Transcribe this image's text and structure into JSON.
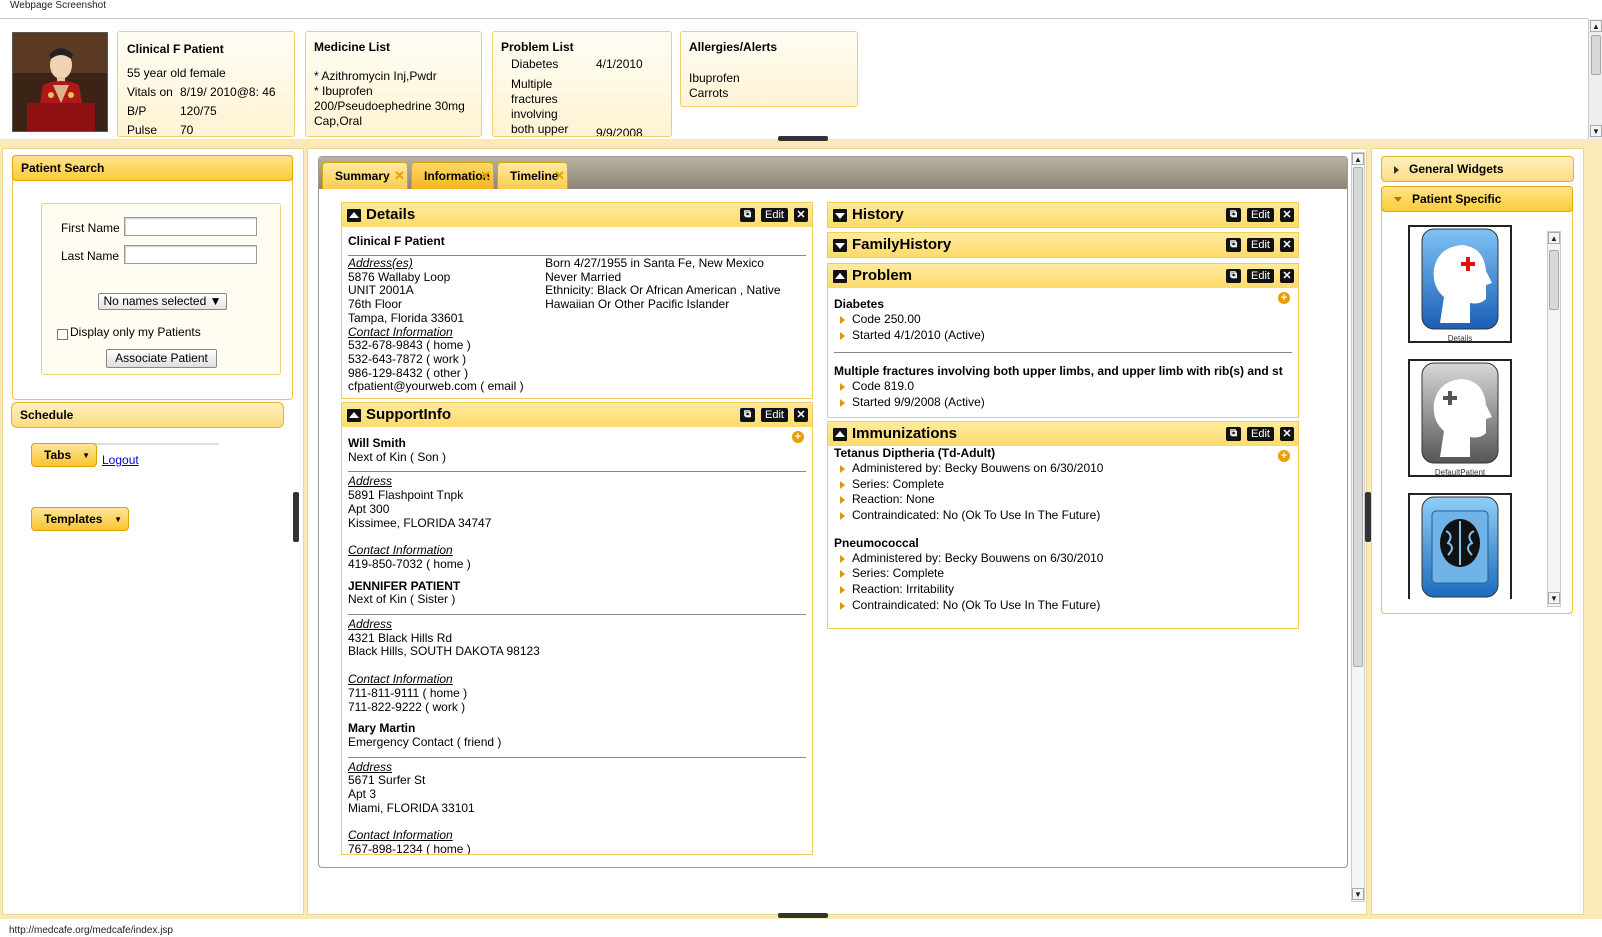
{
  "window": {
    "title": "Webpage Screenshot"
  },
  "header": {
    "patient": {
      "name": "Clinical F Patient",
      "desc": "55 year old female",
      "vitals_label": "Vitals on",
      "vitals_date": "8/19/ 2010@8: 46",
      "bp_label": "B/P",
      "bp": "120/75",
      "pulse_label": "Pulse",
      "pulse": "70"
    },
    "medicine": {
      "title": "Medicine List",
      "items": [
        "* Azithromycin Inj,Pwdr",
        "* Ibuprofen",
        "200/Pseudoephedrine 30mg",
        "Cap,Oral"
      ]
    },
    "problems": {
      "title": "Problem List",
      "items": [
        {
          "name": "Diabetes",
          "date": "4/1/2010"
        },
        {
          "name": "Multiple",
          "date": ""
        },
        {
          "name": "fractures",
          "date": ""
        },
        {
          "name": "involving",
          "date": ""
        },
        {
          "name": "both upper",
          "date": "9/9/2008"
        }
      ]
    },
    "allergies": {
      "title": "Allergies/Alerts",
      "items": [
        "Ibuprofen",
        "Carrots"
      ]
    }
  },
  "left": {
    "patient_search": {
      "title": "Patient Search",
      "first_name_label": "First Name",
      "last_name_label": "Last Name",
      "first_name_value": "",
      "last_name_value": "",
      "names_select": "No names selected",
      "only_mine_label": "Display only my Patients",
      "associate_label": "Associate Patient"
    },
    "schedule_title": "Schedule",
    "tabs_label": "Tabs",
    "logout_label": "Logout",
    "templates_label": "Templates"
  },
  "center": {
    "tabs": [
      {
        "label": "Summary",
        "active": false
      },
      {
        "label": "Information",
        "active": true
      },
      {
        "label": "Timeline",
        "active": false
      }
    ],
    "edit_label": "Edit",
    "details": {
      "title": "Details",
      "name": "Clinical F Patient",
      "address_label": "Address(es)",
      "address_lines": [
        "5876 Wallaby Loop",
        "UNIT 2001A",
        "76th Floor",
        "Tampa, Florida 33601"
      ],
      "contact_label": "Contact Information",
      "contact_lines": [
        "532-678-9843 ( home )",
        "532-643-7872 ( work )",
        "986-129-8432 ( other )",
        "cfpatient@yourweb.com ( email )"
      ],
      "right_lines": [
        "Born 4/27/1955 in Santa Fe, New Mexico",
        "Never Married",
        "Ethnicity: Black Or African American , Native",
        "Hawaiian Or Other Pacific Islander"
      ]
    },
    "support": {
      "title": "SupportInfo",
      "address_label": "Address",
      "contact_label": "Contact Information",
      "people": [
        {
          "name": "Will Smith",
          "relation": "Next of Kin ( Son )",
          "address": [
            "5891 Flashpoint Tnpk",
            "Apt 300",
            "Kissimee, FLORIDA 34747"
          ],
          "contacts": [
            "419-850-7032 ( home )"
          ]
        },
        {
          "name": "JENNIFER PATIENT",
          "relation": "Next of Kin ( Sister )",
          "address": [
            "4321 Black Hills Rd",
            "Black Hills, SOUTH DAKOTA 98123"
          ],
          "contacts": [
            "711-811-9111 ( home )",
            "711-822-9222 ( work )"
          ]
        },
        {
          "name": "Mary Martin",
          "relation": "Emergency Contact ( friend )",
          "address": [
            "5671 Surfer St",
            "Apt 3",
            "Miami, FLORIDA 33101"
          ],
          "contacts": [
            "767-898-1234 ( home )"
          ]
        }
      ]
    },
    "history": {
      "title": "History"
    },
    "family_history": {
      "title": "FamilyHistory"
    },
    "problem": {
      "title": "Problem",
      "items": [
        {
          "name": "Diabetes",
          "code": "Code 250.00",
          "started": "Started 4/1/2010 (Active)"
        },
        {
          "name": "Multiple fractures involving both upper limbs, and upper limb with rib(s) and st",
          "code": "Code 819.0",
          "started": "Started 9/9/2008 (Active)"
        }
      ]
    },
    "immunizations": {
      "title": "Immunizations",
      "items": [
        {
          "name": "Tetanus Diptheria (Td-Adult)",
          "lines": [
            "Administered by: Becky Bouwens on 6/30/2010",
            "Series: Complete",
            "Reaction: None",
            "Contraindicated: No (Ok To Use In The Future)"
          ]
        },
        {
          "name": "Pneumococcal",
          "lines": [
            "Administered by: Becky Bouwens on 6/30/2010",
            "Series: Complete",
            "Reaction: Irritability",
            "Contraindicated: No (Ok To Use In The Future)"
          ]
        }
      ]
    }
  },
  "right": {
    "general_widgets": "General Widgets",
    "patient_specific": "Patient Specific",
    "widgets": [
      {
        "label": "Details",
        "icon": "head-medical-icon"
      },
      {
        "label": "DefaultPatient",
        "icon": "head-grey-icon"
      },
      {
        "label": "",
        "icon": "brain-icon"
      }
    ]
  },
  "status": {
    "url": "http://medcafe.org/medcafe/index.jsp"
  },
  "colors": {
    "accent": "#fbd35a",
    "accent_border": "#e0a800",
    "frame": "#fbe9b8",
    "link": "#0000cc"
  }
}
